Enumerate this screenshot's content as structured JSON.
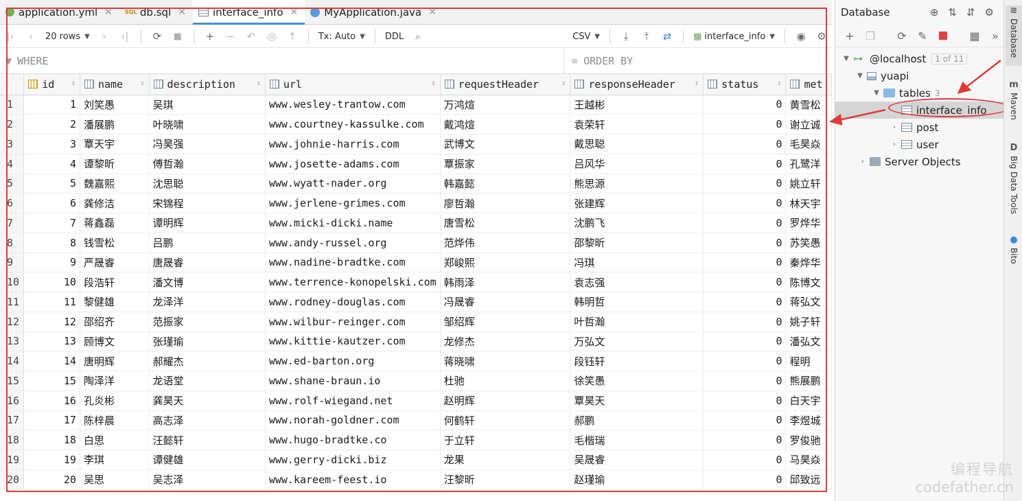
{
  "tabs": [
    {
      "label": "application.yml",
      "icon": "yml-file-icon"
    },
    {
      "label": "db.sql",
      "icon": "sql-file-icon"
    },
    {
      "label": "interface_info",
      "icon": "table-icon",
      "active": true
    },
    {
      "label": "MyApplication.java",
      "icon": "java-file-icon"
    }
  ],
  "toolbar": {
    "rows_label": "20 rows",
    "tx_label": "Tx: Auto",
    "ddl_label": "DDL",
    "export_label": "CSV",
    "datasource_label": "interface_info"
  },
  "filter": {
    "where_placeholder": "WHERE",
    "order_placeholder": "ORDER BY"
  },
  "grid": {
    "columns": [
      "id",
      "name",
      "description",
      "url",
      "requestHeader",
      "responseHeader",
      "status",
      "met"
    ],
    "rows": [
      [
        "1",
        "1",
        "刘笑愚",
        "吴琪",
        "www.wesley-trantow.com",
        "万鸿煊",
        "王越彬",
        "0",
        "黄雪松"
      ],
      [
        "2",
        "2",
        "潘展鹏",
        "叶晓啸",
        "www.courtney-kassulke.com",
        "戴鸿煊",
        "袁荣轩",
        "0",
        "谢立诚"
      ],
      [
        "3",
        "3",
        "覃天宇",
        "冯昊强",
        "www.johnie-harris.com",
        "武博文",
        "戴思聪",
        "0",
        "毛昊焱"
      ],
      [
        "4",
        "4",
        "谭黎昕",
        "傅哲瀚",
        "www.josette-adams.com",
        "覃振家",
        "吕风华",
        "0",
        "孔鹭洋"
      ],
      [
        "5",
        "5",
        "魏嘉熙",
        "沈思聪",
        "www.wyatt-nader.org",
        "韩嘉懿",
        "熊思源",
        "0",
        "姚立轩"
      ],
      [
        "6",
        "6",
        "龚修洁",
        "宋锦程",
        "www.jerlene-grimes.com",
        "廖哲瀚",
        "张建辉",
        "0",
        "林天宇"
      ],
      [
        "7",
        "7",
        "蒋鑫磊",
        "谭明辉",
        "www.micki-dicki.name",
        "唐雪松",
        "沈鹏飞",
        "0",
        "罗烨华"
      ],
      [
        "8",
        "8",
        "钱雪松",
        "吕鹏",
        "www.andy-russel.org",
        "范烨伟",
        "邵黎昕",
        "0",
        "苏笑愚"
      ],
      [
        "9",
        "9",
        "严晟睿",
        "唐晟睿",
        "www.nadine-bradtke.com",
        "郑峻熙",
        "冯琪",
        "0",
        "秦烨华"
      ],
      [
        "10",
        "10",
        "段浩轩",
        "潘文博",
        "www.terrence-konopelski.com",
        "韩雨泽",
        "袁志强",
        "0",
        "陈博文"
      ],
      [
        "11",
        "11",
        "黎健雄",
        "龙泽洋",
        "www.rodney-douglas.com",
        "冯晟睿",
        "韩明哲",
        "0",
        "蒋弘文"
      ],
      [
        "12",
        "12",
        "邵绍齐",
        "范振家",
        "www.wilbur-reinger.com",
        "邹绍辉",
        "叶哲瀚",
        "0",
        "姚子轩"
      ],
      [
        "13",
        "13",
        "顾博文",
        "张瑾瑜",
        "www.kittie-kautzer.com",
        "龙修杰",
        "万弘文",
        "0",
        "潘弘文"
      ],
      [
        "14",
        "14",
        "唐明辉",
        "郝耀杰",
        "www.ed-barton.org",
        "蒋晓啸",
        "段钰轩",
        "0",
        "程明"
      ],
      [
        "15",
        "15",
        "陶泽洋",
        "龙语堂",
        "www.shane-braun.io",
        "杜驰",
        "徐笑愚",
        "0",
        "熊展鹏"
      ],
      [
        "16",
        "16",
        "孔炎彬",
        "龚昊天",
        "www.rolf-wiegand.net",
        "赵明辉",
        "覃昊天",
        "0",
        "白天宇"
      ],
      [
        "17",
        "17",
        "陈梓晨",
        "高志泽",
        "www.norah-goldner.com",
        "何鹤轩",
        "郝鹏",
        "0",
        "李煜城"
      ],
      [
        "18",
        "18",
        "白思",
        "汪懿轩",
        "www.hugo-bradtke.co",
        "于立轩",
        "毛楷瑞",
        "0",
        "罗俊驰"
      ],
      [
        "19",
        "19",
        "李琪",
        "谭健雄",
        "www.gerry-dicki.biz",
        "龙果",
        "吴晟睿",
        "0",
        "马昊焱"
      ],
      [
        "20",
        "20",
        "吴思",
        "吴志泽",
        "www.kareem-feest.io",
        "汪黎昕",
        "赵瑾瑜",
        "0",
        "邱致远"
      ]
    ]
  },
  "db": {
    "title": "Database",
    "tree": {
      "connection": "@localhost",
      "connection_badge": "1 of 11",
      "schema": "yuapi",
      "folder": "tables",
      "folder_count": "3",
      "tables": [
        "interface_info",
        "post",
        "user"
      ],
      "server_objects": "Server Objects"
    }
  },
  "strip": {
    "tools": [
      "Database",
      "Maven",
      "Big Data Tools",
      "Bito"
    ]
  },
  "watermark": {
    "line1": "编程导航",
    "line2": "codefather.cn"
  },
  "colors": {
    "annotation_red": "#e03a3a",
    "active_tab_accent": "#4a8fd4",
    "selection_gray": "#d5d5d5"
  }
}
